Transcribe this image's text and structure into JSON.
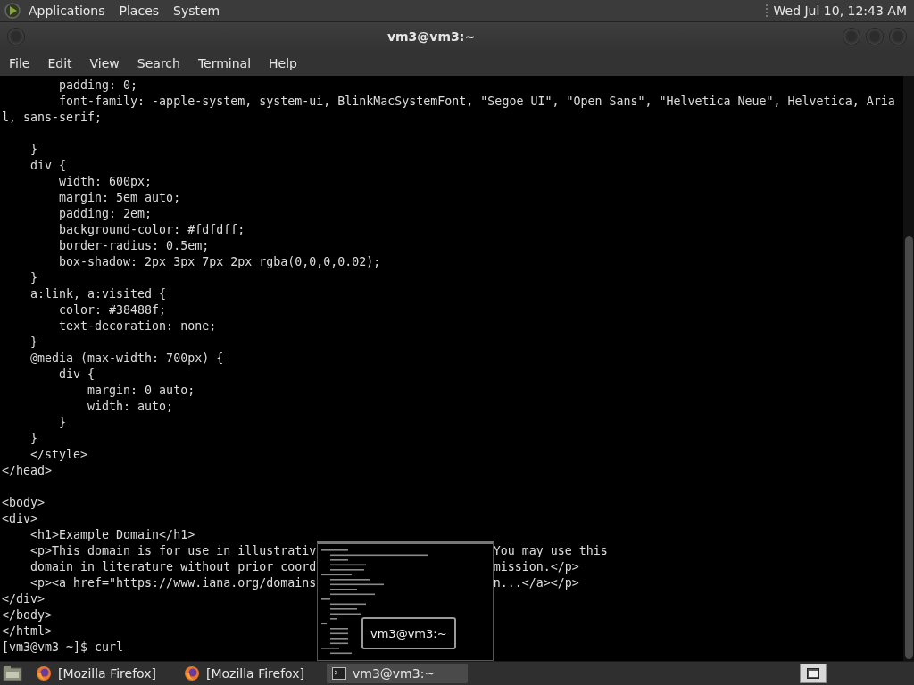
{
  "top_panel": {
    "menus": [
      "Applications",
      "Places",
      "System"
    ],
    "clock": "Wed Jul 10, 12:43 AM"
  },
  "window": {
    "title": "vm3@vm3:~"
  },
  "menu_bar": [
    "File",
    "Edit",
    "View",
    "Search",
    "Terminal",
    "Help"
  ],
  "terminal": {
    "lines": [
      {
        "kind": "text",
        "text": "        padding: 0;"
      },
      {
        "kind": "text",
        "text": "        font-family: -apple-system, system-ui, BlinkMacSystemFont, \"Segoe UI\", \"Open Sans\", \"Helvetica Neue\", Helvetica, Aria"
      },
      {
        "kind": "text",
        "text": "l, sans-serif;"
      },
      {
        "kind": "blank"
      },
      {
        "kind": "text",
        "text": "    }"
      },
      {
        "kind": "text",
        "text": "    div {"
      },
      {
        "kind": "text",
        "text": "        width: 600px;"
      },
      {
        "kind": "text",
        "text": "        margin: 5em auto;"
      },
      {
        "kind": "text",
        "text": "        padding: 2em;"
      },
      {
        "kind": "text",
        "text": "        background-color: #fdfdff;"
      },
      {
        "kind": "text",
        "text": "        border-radius: 0.5em;"
      },
      {
        "kind": "text",
        "text": "        box-shadow: 2px 3px 7px 2px rgba(0,0,0,0.02);"
      },
      {
        "kind": "text",
        "text": "    }"
      },
      {
        "kind": "text",
        "text": "    a:link, a:visited {"
      },
      {
        "kind": "text",
        "text": "        color: #38488f;"
      },
      {
        "kind": "text",
        "text": "        text-decoration: none;"
      },
      {
        "kind": "text",
        "text": "    }"
      },
      {
        "kind": "text",
        "text": "    @media (max-width: 700px) {"
      },
      {
        "kind": "text",
        "text": "        div {"
      },
      {
        "kind": "text",
        "text": "            margin: 0 auto;"
      },
      {
        "kind": "text",
        "text": "            width: auto;"
      },
      {
        "kind": "text",
        "text": "        }"
      },
      {
        "kind": "text",
        "text": "    }"
      },
      {
        "kind": "text",
        "text": "    </style>"
      },
      {
        "kind": "text",
        "text": "</head>"
      },
      {
        "kind": "blank"
      },
      {
        "kind": "text",
        "text": "<body>"
      },
      {
        "kind": "text",
        "text": "<div>"
      },
      {
        "kind": "text",
        "text": "    <h1>Example Domain</h1>"
      },
      {
        "kind": "split",
        "text": "    <p>This domain is for use in illustrativ",
        "text_after": "You may use this"
      },
      {
        "kind": "split",
        "text": "    domain in literature without prior coord",
        "text_after": "mission.</p>"
      },
      {
        "kind": "split",
        "text": "    <p><a href=\"https://www.iana.org/domains",
        "text_after": "n...</a></p>"
      },
      {
        "kind": "text",
        "text": "</div>"
      },
      {
        "kind": "text",
        "text": "</body>"
      },
      {
        "kind": "text",
        "text": "</html>"
      },
      {
        "kind": "text",
        "text": "[vm3@vm3 ~]$ curl"
      }
    ]
  },
  "preview": {
    "tooltip": "vm3@vm3:~"
  },
  "taskbar": {
    "tasks": [
      {
        "kind": "browser",
        "label": "[Mozilla Firefox]",
        "selected": false
      },
      {
        "kind": "browser",
        "label": "[Mozilla Firefox]",
        "selected": false
      },
      {
        "kind": "terminal",
        "label": "vm3@vm3:~",
        "selected": true
      }
    ]
  }
}
